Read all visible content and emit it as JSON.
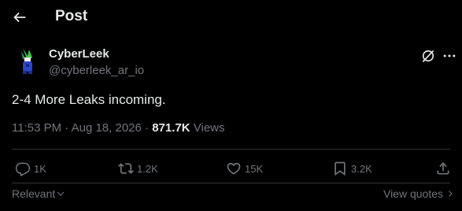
{
  "header": {
    "title": "Post"
  },
  "author": {
    "name": "CyberLeek",
    "handle": "@cyberleek_ar_io"
  },
  "post": {
    "text": "2-4 More Leaks incoming.",
    "time": "11:53 PM",
    "date": "Aug 18, 2026",
    "views_count": "871.7K",
    "views_label": "Views"
  },
  "actions": {
    "replies": "1K",
    "reposts": "1.2K",
    "likes": "15K",
    "bookmarks": "3.2K"
  },
  "footer": {
    "sort_label": "Relevant",
    "quotes_label": "View quotes"
  },
  "colors": {
    "background": "#000000",
    "text": "#e7e9ea",
    "muted": "#71767b",
    "divider": "#2f3336"
  }
}
